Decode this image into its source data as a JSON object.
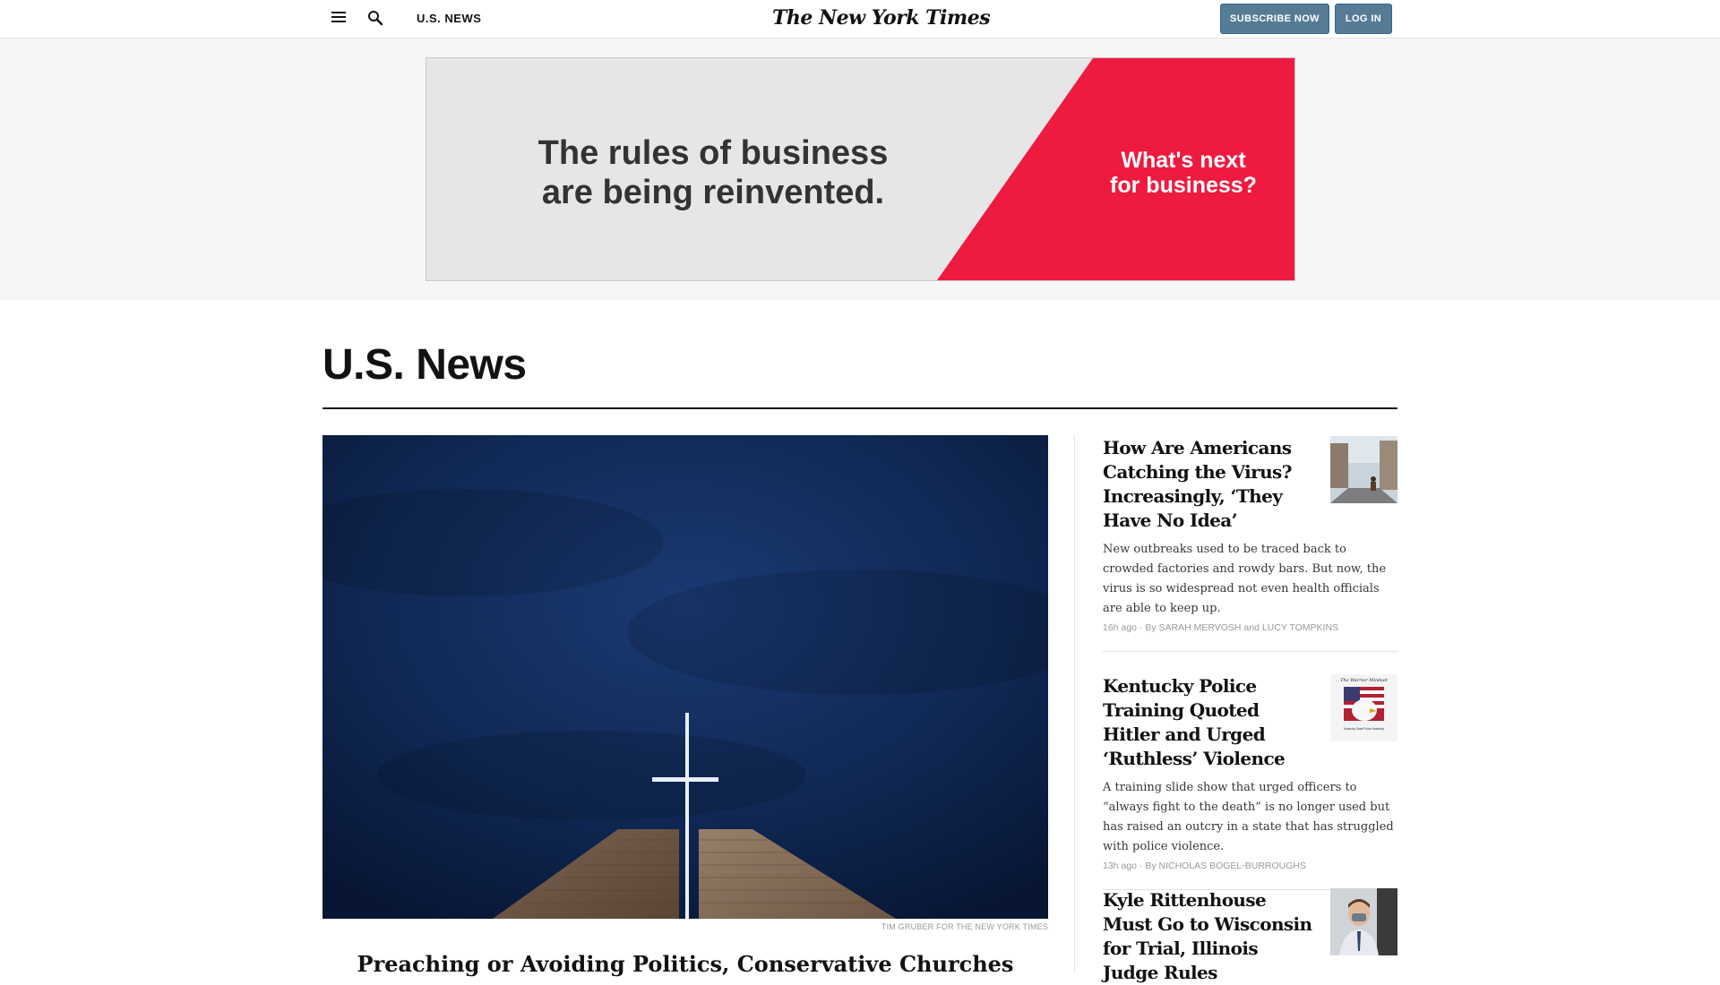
{
  "header": {
    "section": "U.S. NEWS",
    "logo": "The New York Times",
    "subscribe_label": "SUBSCRIBE NOW",
    "login_label": "LOG IN"
  },
  "ad": {
    "left_line1": "The rules of business",
    "left_line2": "are being reinvented.",
    "right_line1": "What's next",
    "right_line2": "for business?",
    "colors": {
      "background": "#e6e6e6",
      "accent": "#ef1a40"
    }
  },
  "page": {
    "title": "U.S. News"
  },
  "lead": {
    "credit": "TIM GRUBER FOR THE NEW YORK TIMES",
    "headline": "Preaching or Avoiding Politics, Conservative Churches"
  },
  "stories": [
    {
      "headline": "How Are Americans Catching the Virus? Increasingly, ‘They Have No Idea’",
      "summary": "New outbreaks used to be traced back to crowded factories and rowdy bars. But now, the virus is so widespread not even health officials are able to keep up.",
      "time": "16h ago",
      "byline": "By SARAH MERVOSH and LUCY TOMPKINS"
    },
    {
      "headline": "Kentucky Police Training Quoted Hitler and Urged ‘Ruthless’ Violence",
      "summary": "A training slide show that urged officers to “always fight to the death” is no longer used but has raised an outcry in a state that has struggled with police violence.",
      "time": "13h ago",
      "byline": "By NICHOLAS BOGEL-BURROUGHS",
      "thumb_title": "The Warrior Mindset",
      "thumb_caption": "Kentucky State Police Academy"
    },
    {
      "headline": "Kyle Rittenhouse Must Go to Wisconsin for Trial, Illinois Judge Rules"
    }
  ],
  "colors": {
    "button": "#567b95",
    "sky": "#0f2752",
    "brick": "#8a6f58"
  }
}
